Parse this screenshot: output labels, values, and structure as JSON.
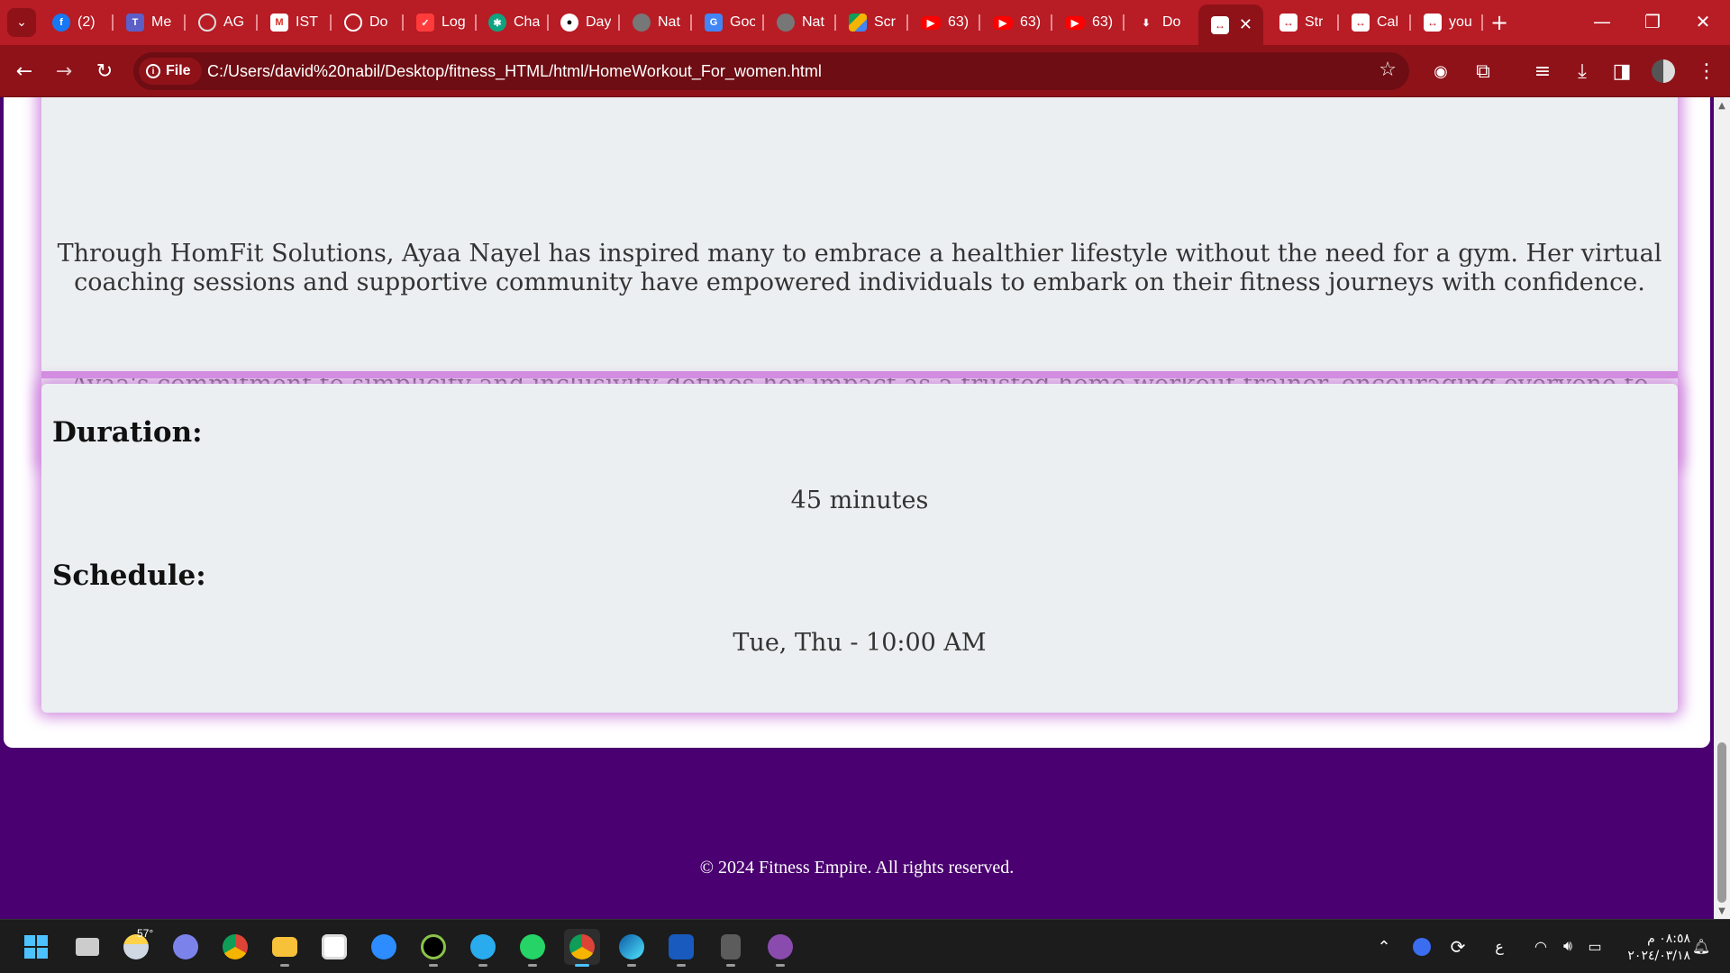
{
  "browser": {
    "tabs": [
      {
        "title": "(2)",
        "icon": "facebook-icon"
      },
      {
        "title": "Me",
        "icon": "teams-icon"
      },
      {
        "title": "AG",
        "icon": "ag-icon"
      },
      {
        "title": "IST",
        "icon": "gmail-icon"
      },
      {
        "title": "Do",
        "icon": "circle-icon"
      },
      {
        "title": "Log",
        "icon": "todoist-icon"
      },
      {
        "title": "Cha",
        "icon": "chatgpt-icon"
      },
      {
        "title": "Day",
        "icon": "github-icon"
      },
      {
        "title": "Nat",
        "icon": "globe-icon"
      },
      {
        "title": "Goo",
        "icon": "google-translate-icon"
      },
      {
        "title": "Nat",
        "icon": "globe-icon"
      },
      {
        "title": "Scr",
        "icon": "google-drive-icon"
      },
      {
        "title": "63)",
        "icon": "youtube-icon"
      },
      {
        "title": "63)",
        "icon": "youtube-icon"
      },
      {
        "title": "63)",
        "icon": "youtube-icon"
      },
      {
        "title": "Do",
        "icon": "download-icon"
      },
      {
        "title": "",
        "icon": "arrows-icon",
        "active": true
      },
      {
        "title": "Str",
        "icon": "arrows-icon"
      },
      {
        "title": "Cal",
        "icon": "arrows-icon"
      },
      {
        "title": "you",
        "icon": "arrows-icon"
      }
    ],
    "address_bar": {
      "chip_label": "File",
      "url": "C:/Users/david%20nabil/Desktop/fitness_HTML/html/HomeWorkout_For_women.html"
    },
    "theme_color": "#b81c25"
  },
  "page": {
    "bio": {
      "paragraph_1": "Through HomFit Solutions, Ayaa Nayel has inspired many to embrace a healthier lifestyle without the need for a gym. Her virtual coaching sessions and supportive community have empowered individuals to embark on their fitness journeys with confidence.",
      "paragraph_2": "Ayaa's commitment to simplicity and inclusivity defines her impact as a trusted home workout trainer, encouraging everyone to prioritize their well-being in a convenient and accessible way.\""
    },
    "session": {
      "duration_label": "Duration:",
      "duration_value": "45 minutes",
      "schedule_label": "Schedule:",
      "schedule_value": "Tue, Thu - 10:00 AM"
    },
    "footer": {
      "copyright": "© 2024 Fitness Empire. All rights reserved."
    },
    "colors": {
      "card_background": "#eceff1",
      "card_glow": "#d28de0",
      "footer_background": "#4a0070"
    }
  },
  "taskbar": {
    "weather_temp": "57°",
    "tray_language": "ع",
    "clock_time": "٠٨:٥٨ م",
    "clock_date": "٢٠٢٤/٠٣/١٨"
  }
}
